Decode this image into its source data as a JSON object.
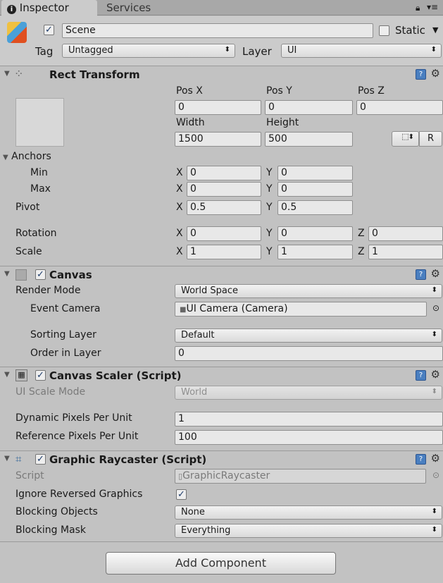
{
  "tabs": [
    {
      "label": "Inspector",
      "active": true
    },
    {
      "label": "Services",
      "active": false
    }
  ],
  "object": {
    "active": true,
    "name": "Scene",
    "static_label": "Static",
    "static": false,
    "tag_label": "Tag",
    "tag": "Untagged",
    "layer_label": "Layer",
    "layer": "UI"
  },
  "rect_transform": {
    "title": "Rect Transform",
    "pos_x_label": "Pos X",
    "pos_y_label": "Pos Y",
    "pos_z_label": "Pos Z",
    "pos_x": "0",
    "pos_y": "0",
    "pos_z": "0",
    "width_label": "Width",
    "height_label": "Height",
    "width": "1500",
    "height": "500",
    "raw_button": "R",
    "anchors_label": "Anchors",
    "min_label": "Min",
    "max_label": "Max",
    "pivot_label": "Pivot",
    "rotation_label": "Rotation",
    "scale_label": "Scale",
    "x": "X",
    "y": "Y",
    "z": "Z",
    "min_x": "0",
    "min_y": "0",
    "max_x": "0",
    "max_y": "0",
    "pivot_x": "0.5",
    "pivot_y": "0.5",
    "rot_x": "0",
    "rot_y": "0",
    "rot_z": "0",
    "scale_x": "1",
    "scale_y": "1",
    "scale_z": "1"
  },
  "canvas": {
    "title": "Canvas",
    "enabled": true,
    "render_mode_label": "Render Mode",
    "render_mode": "World Space",
    "event_camera_label": "Event Camera",
    "event_camera": "UI Camera (Camera)",
    "sorting_layer_label": "Sorting Layer",
    "sorting_layer": "Default",
    "order_label": "Order in Layer",
    "order": "0"
  },
  "canvas_scaler": {
    "title": "Canvas Scaler (Script)",
    "enabled": true,
    "ui_scale_mode_label": "UI Scale Mode",
    "ui_scale_mode": "World",
    "dynamic_label": "Dynamic Pixels Per Unit",
    "dynamic": "1",
    "reference_label": "Reference Pixels Per Unit",
    "reference": "100"
  },
  "graphic_raycaster": {
    "title": "Graphic Raycaster (Script)",
    "enabled": true,
    "script_label": "Script",
    "script": "GraphicRaycaster",
    "ignore_label": "Ignore Reversed Graphics",
    "ignore": true,
    "blocking_objects_label": "Blocking Objects",
    "blocking_objects": "None",
    "blocking_mask_label": "Blocking Mask",
    "blocking_mask": "Everything"
  },
  "add_component": "Add Component"
}
